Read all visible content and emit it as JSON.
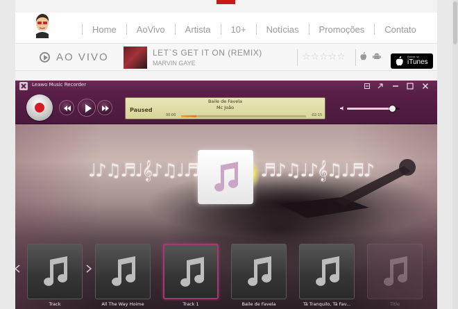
{
  "site": {
    "nav": [
      {
        "label": "Home"
      },
      {
        "label": "AoVivo"
      },
      {
        "label": "Artista"
      },
      {
        "label": "10+"
      },
      {
        "label": "Notícias"
      },
      {
        "label": "Promoções"
      },
      {
        "label": "Contato"
      }
    ],
    "live_label": "AO VIVO",
    "now_playing": {
      "title": "LET`S GET IT ON (REMIX)",
      "artist": "MARVIN GAYE"
    },
    "rating_stars": "☆☆☆☆☆",
    "itunes": {
      "small": "Baixar no",
      "label": "iTunes"
    }
  },
  "app": {
    "title": "Leawo Music Recorder",
    "display": {
      "song": "Baile de Favela",
      "artist": "Mc João",
      "status": "Paused",
      "time_elapsed": "00:00",
      "time_total": "-02:15",
      "progress": 0.12
    },
    "volume": 0.85,
    "notes_left": "♩♪♫♬♩𝄞♪♫♩♬",
    "notes_right": "♬♪♫♩♪𝄞♫♩♬♪",
    "albums": [
      {
        "label": "Track"
      },
      {
        "label": "All The Way Hoime"
      },
      {
        "label": "Track 1"
      },
      {
        "label": "Baile de Favela"
      },
      {
        "label": "Tá Tranquilo, Tá Fav..."
      },
      {
        "label": "Title"
      }
    ],
    "selected_album": 2
  },
  "colors": {
    "brand_red": "#c8191f",
    "app_purple": "#5a1f48",
    "record_red": "#d21d27",
    "progress_orange": "#d97f24"
  },
  "icons": [
    "avatar-logo",
    "play-circle-icon",
    "star-icon",
    "apple-icon",
    "android-icon",
    "itunes-apple-icon",
    "leawo-logo-icon",
    "record-icon",
    "rewind-icon",
    "play-icon",
    "forward-icon",
    "volume-icon",
    "music-note-icon",
    "window-minimize-icon",
    "window-maximize-icon",
    "window-close-icon"
  ]
}
